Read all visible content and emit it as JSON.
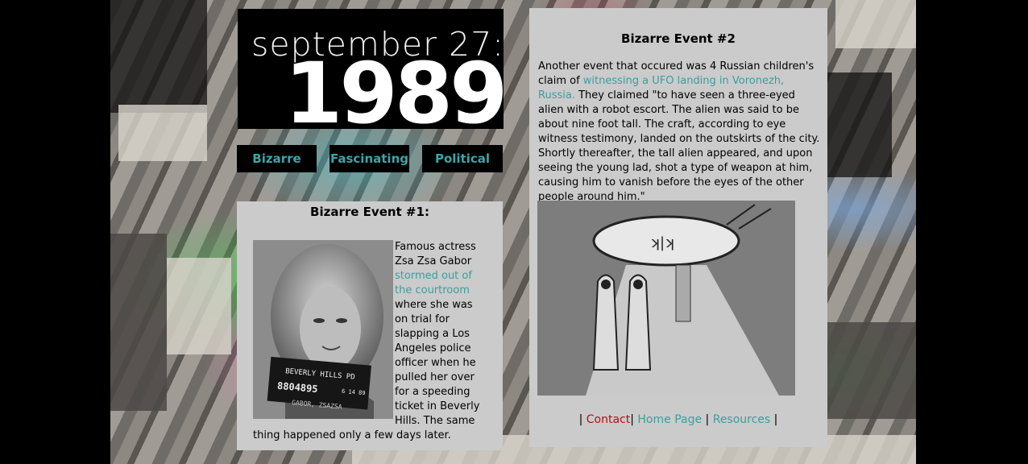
{
  "header": {
    "date": "september 27:",
    "year": "1989"
  },
  "nav": {
    "items": [
      {
        "label": "Bizarre"
      },
      {
        "label": "Fascinating"
      },
      {
        "label": "Political"
      }
    ]
  },
  "event1": {
    "title": "Bizarre Event #1:",
    "text_before": "Famous actress Zsa Zsa Gabor ",
    "link_text": "stormed out of the courtroom",
    "text_after": " where she was on trial for slapping a Los Angeles police officer when he pulled her over for a speeding ticket in Beverly Hills. The same thing happened only a few days later.",
    "mugshot": {
      "line1": "BEVERLY HILLS PD",
      "line2": "8804895",
      "line3": "6 14 89",
      "line4": "GABOR, ZSAZSA"
    }
  },
  "event2": {
    "title": "Bizarre Event #2",
    "text_before": "Another event that occured was 4 Russian children's claim of ",
    "link_text": "witnessing a UFO landing in Voronezh, Russia.",
    "text_after": " They claimed \"to have seen a three-eyed alien with a robot escort. The alien was said to be about nine foot tall. The craft, according to eye witness testimony, landed on the outskirts of the city. Shortly thereafter, the tall alien appeared, and upon seeing the young lad, shot a type of weapon at him, causing him to vanish before the eyes of the other people around him.\""
  },
  "footer": {
    "sep": "|",
    "contact": "Contact",
    "home": "Home Page",
    "resources": "Resources"
  },
  "colors": {
    "link": "#3a9e9e",
    "contact": "#b0121a",
    "panel": "#cbcbcb"
  }
}
